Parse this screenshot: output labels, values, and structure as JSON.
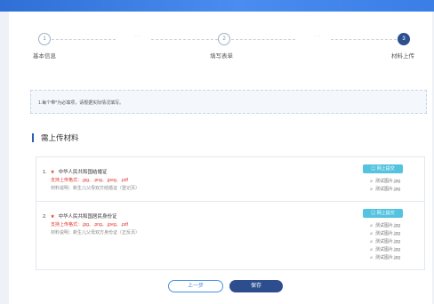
{
  "steps": [
    {
      "number": "1",
      "label": "基本信息"
    },
    {
      "number": "2",
      "label": "填写表单"
    },
    {
      "number": "3",
      "label": "材料上传"
    }
  ],
  "tip": "1.每个带*为必填项，请根据实际情况填写。",
  "section_title": "需上传材料",
  "items": [
    {
      "number": "1.",
      "title": "中华人民共和国结婚证",
      "types": "支持上传格式：.jpg、.png、.jpeg、.pdf",
      "desc": "材料说明：新生儿父母双方结婚证（登记页）",
      "upload_label": "网上提交",
      "files": [
        "测试图片.jpg",
        "测试图片.jpg"
      ]
    },
    {
      "number": "2.",
      "title": "中华人民共和国居民身份证",
      "types": "支持上传格式：.jpg、.png、.jpeg、.pdf",
      "desc": "材料说明：新生儿父母双方身份证（正反页）",
      "upload_label": "网上提交",
      "files": [
        "测试图片.jpg",
        "测试图片.jpg",
        "测试图片.jpg",
        "测试图片.jpg",
        "测试图片.jpg"
      ]
    }
  ],
  "buttons": {
    "prev": "上一步",
    "save": "保存"
  },
  "colors": {
    "accent": "#2d4d8f",
    "required": "#e0342c",
    "upload": "#53c3df",
    "header": "#3a7ee6"
  }
}
